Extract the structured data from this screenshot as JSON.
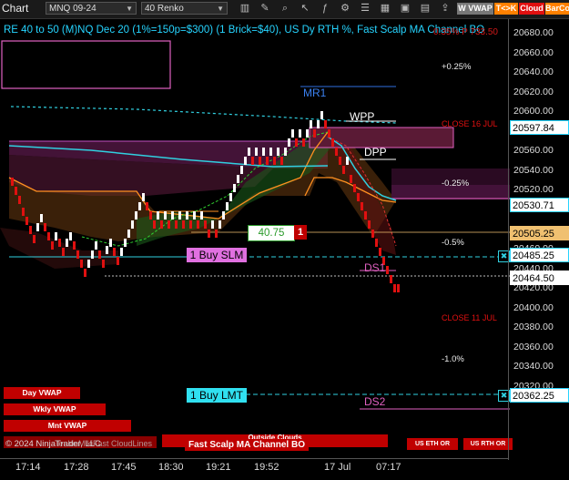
{
  "toolbar": {
    "title": "Chart",
    "instrument": "MNQ 09-24",
    "period": "40 Renko",
    "btn_vwap": "W VWAP",
    "btn_tk": "T<>K",
    "btn_cloud": "Cloud",
    "btn_barco": "BarCo",
    "colors": {
      "cloud": "#e01010",
      "tk": "#ff8000",
      "barco": "#ff8000"
    }
  },
  "header": {
    "text": "RE 40 to 50 (M)NQ Dec 20 (1%=150p=$300) (1 Brick=$40), US Dy RTH %, Fast Scalp MA Channel BO",
    "overlay_red": "0.35% P 733.50"
  },
  "price_axis": {
    "labels": [
      "20680.00",
      "20660.00",
      "20640.00",
      "20620.00",
      "20600.00",
      "20580.00",
      "20560.00",
      "20540.00",
      "20520.00",
      "20500.00",
      "20480.00",
      "20460.00",
      "20440.00",
      "20420.00",
      "20400.00",
      "20380.00",
      "20360.00",
      "20340.00",
      "20320.00"
    ],
    "boxes": [
      {
        "value": "20597.84",
        "color": "#26d4ff"
      },
      {
        "value": "20530.71",
        "color": "#26d4ff"
      },
      {
        "value": "20505.25",
        "color": "#f0c070"
      },
      {
        "value": "20485.25",
        "color": "#26d4ff"
      },
      {
        "value": "20464.50",
        "color": "#ffffff"
      },
      {
        "value": "20362.25",
        "color": "#26d4ff"
      }
    ]
  },
  "time_axis": [
    "17:14",
    "17:28",
    "17:45",
    "18:30",
    "19:21",
    "19:52",
    "17 Jul",
    "07:17"
  ],
  "levels": {
    "mr1": "MR1",
    "wpp": "WPP",
    "dpp": "DPP",
    "ds1": "DS1",
    "ds2": "DS2",
    "close16": "CLOSE 16 JUL",
    "close11": "CLOSE 11 JUL"
  },
  "percents": [
    "+0.25%",
    "-0.25%",
    "-0.5%",
    "-1.0%"
  ],
  "orders": {
    "buy_slm": "1 Buy SLM",
    "buy_lmt": "1 Buy LMT",
    "pnl": "40.75",
    "qty": "1",
    "close_x": "✖"
  },
  "buttons": {
    "day_vwap": "Day VWAP",
    "wkly_vwap": "Wkly VWAP",
    "mnt_vwap": "Mnt VWAP",
    "outside_clouds": "Outside Clouds",
    "fast_scalp": "Fast Scalp MA Channel BO",
    "us_eth_or": "US ETH OR",
    "us_rth_or": "US RTH OR"
  },
  "copyright": "© 2024 NinjaTrader, LLC",
  "watermark": "TenkinMikiFast CloudLines"
}
